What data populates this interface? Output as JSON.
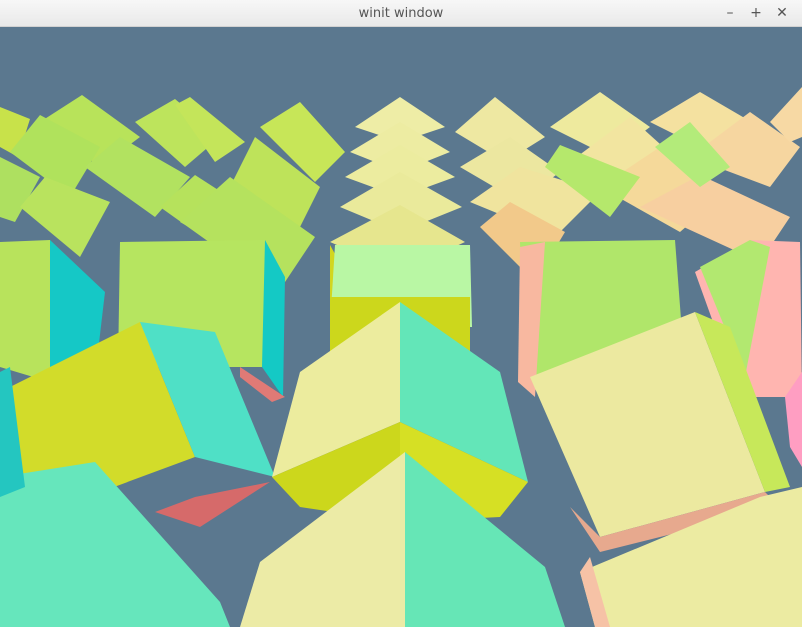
{
  "window": {
    "title": "winit window",
    "controls": {
      "minimize": "–",
      "maximize": "+",
      "close": "✕"
    }
  },
  "scene": {
    "background": "#5b788f",
    "palette": {
      "lime": "#b7e85e",
      "yellow": "#d6dc2a",
      "cyan": "#16c9c8",
      "mint": "#63e6b8",
      "cream": "#eceba3",
      "peach": "#f6cf8e",
      "pink": "#ffb5b0"
    }
  }
}
